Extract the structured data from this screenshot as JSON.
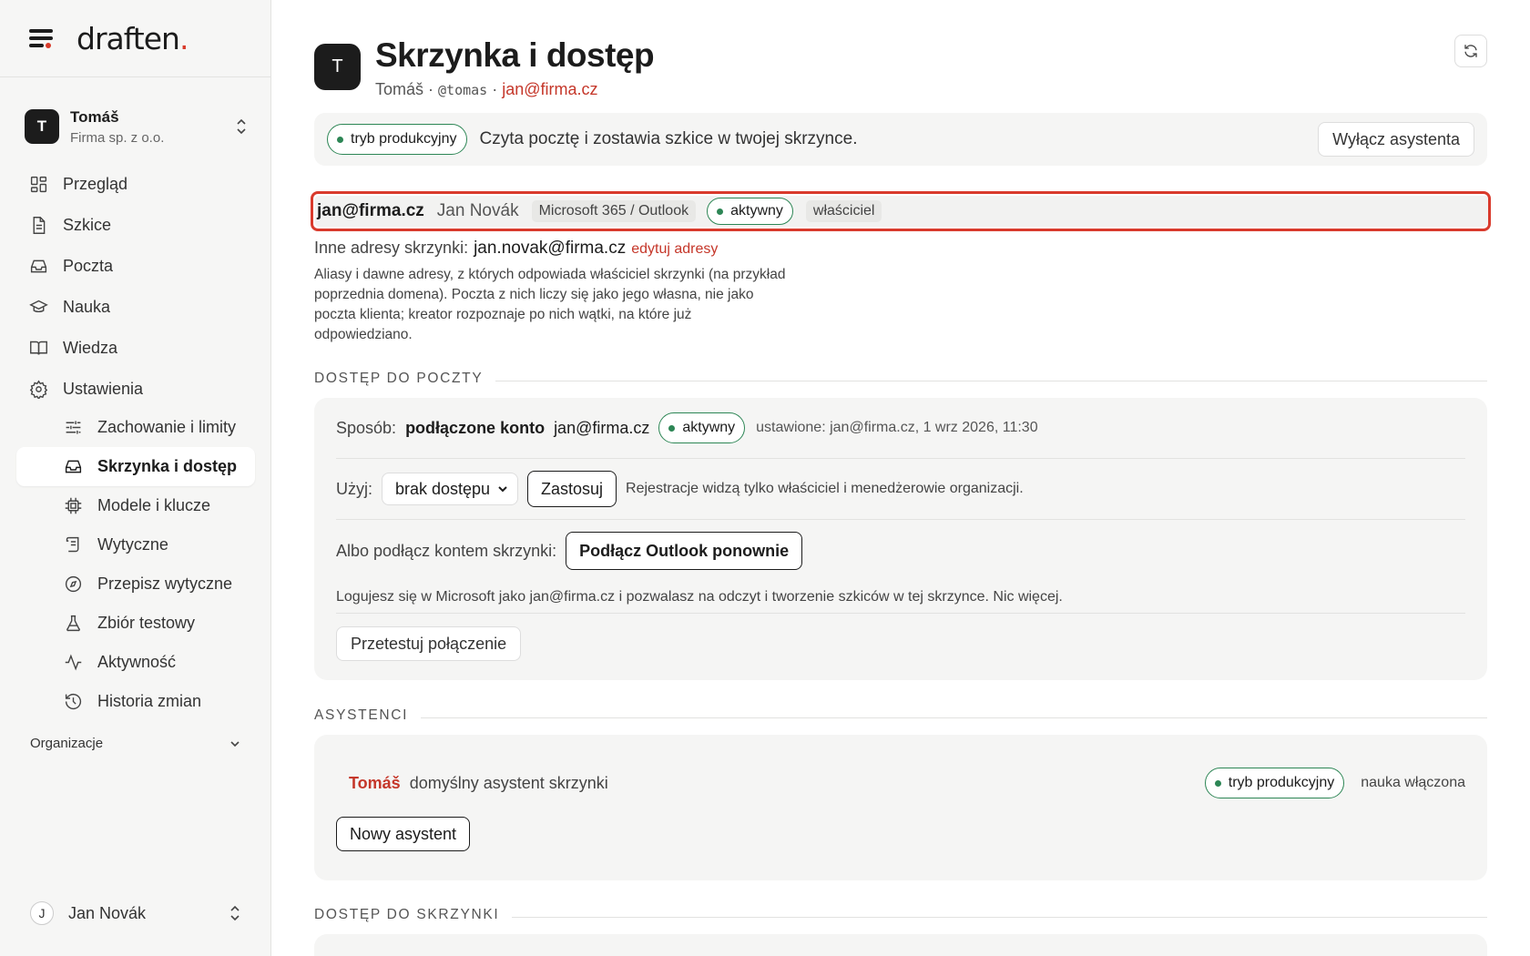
{
  "app": {
    "logo": "draften",
    "logo_dot": "."
  },
  "org": {
    "initial": "T",
    "name": "Tomáš",
    "company": "Firma sp. z o.o."
  },
  "nav": {
    "items": [
      {
        "label": "Przegląd"
      },
      {
        "label": "Szkice"
      },
      {
        "label": "Poczta"
      },
      {
        "label": "Nauka"
      },
      {
        "label": "Wiedza"
      },
      {
        "label": "Ustawienia"
      }
    ],
    "settings": [
      {
        "label": "Zachowanie i limity"
      },
      {
        "label": "Skrzynka i dostęp"
      },
      {
        "label": "Modele i klucze"
      },
      {
        "label": "Wytyczne"
      },
      {
        "label": "Przepisz wytyczne"
      },
      {
        "label": "Zbiór testowy"
      },
      {
        "label": "Aktywność"
      },
      {
        "label": "Historia zmian"
      }
    ],
    "organizations": "Organizacje"
  },
  "user": {
    "initial": "J",
    "name": "Jan Novák"
  },
  "header": {
    "initial": "T",
    "title": "Skrzynka i dostęp",
    "name": "Tomáš",
    "sep": " · ",
    "handle": "@tomas",
    "email": "jan@firma.cz"
  },
  "status": {
    "mode": "tryb produkcyjny",
    "text": "Czyta pocztę i zostawia szkice w twojej skrzynce.",
    "disable_button": "Wyłącz asystenta"
  },
  "account": {
    "email": "jan@firma.cz",
    "name": "Jan Novák",
    "provider": "Microsoft 365 / Outlook",
    "state": "aktywny",
    "role": "właściciel"
  },
  "aliases": {
    "label": "Inne adresy skrzynki:",
    "address": "jan.novak@firma.cz",
    "edit": "edytuj adresy",
    "note": "Aliasy i dawne adresy, z których odpowiada właściciel skrzynki (na przykład poprzednia domena). Poczta z nich liczy się jako jego własna, nie jako poczta klienta; kreator rozpoznaje po nich wątki, na które już odpowiedziano."
  },
  "mail_access": {
    "heading": "DOSTĘP DO POCZTY",
    "method_label": "Sposób:",
    "method": "podłączone konto",
    "method_email": "jan@firma.cz",
    "state": "aktywny",
    "set_info": "ustawione: jan@firma.cz, 1 wrz 2026, 11:30",
    "use_label": "Użyj:",
    "use_value": "brak dostępu",
    "apply": "Zastosuj",
    "use_note": "Rejestracje widzą tylko właściciel i menedżerowie organizacji.",
    "connect_label": "Albo podłącz kontem skrzynki:",
    "connect_button": "Podłącz Outlook ponownie",
    "connect_note": "Logujesz się w Microsoft jako jan@firma.cz i pozwalasz na odczyt i tworzenie szkiców w tej skrzynce. Nic więcej.",
    "test_button": "Przetestuj połączenie"
  },
  "assistants": {
    "heading": "ASYSTENCI",
    "name": "Tomáš",
    "role": "domyślny asystent skrzynki",
    "mode": "tryb produkcyjny",
    "learning": "nauka włączona",
    "new_button": "Nowy asystent"
  },
  "mailbox_access": {
    "heading": "DOSTĘP DO SKRZYNKI"
  },
  "colors": {
    "accent": "#c5372a",
    "green": "#2d8655",
    "highlight": "#d93a2c"
  }
}
